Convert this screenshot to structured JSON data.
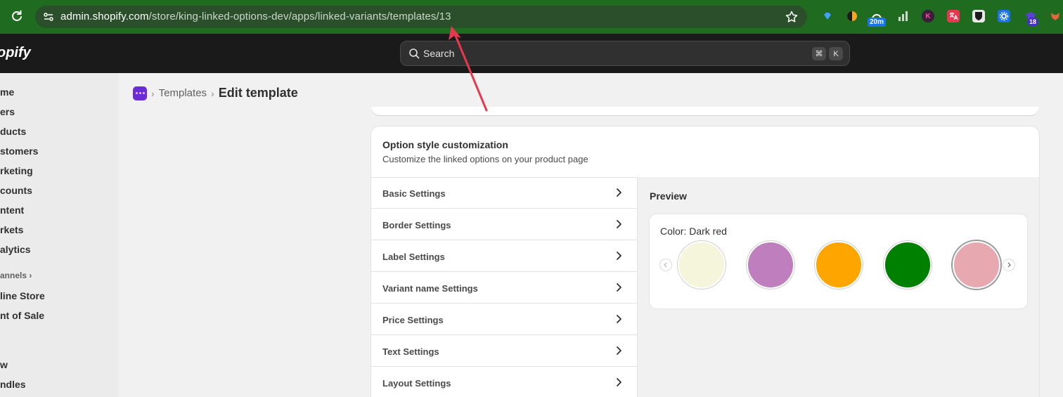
{
  "browser": {
    "url_host": "admin.shopify.com",
    "url_path": "/store/king-linked-options-dev/apps/linked-variants/templates/13",
    "badge_timer": "20m",
    "badge_count": "18",
    "ext_k": "K"
  },
  "topbar": {
    "logo": "opify",
    "search_placeholder": "Search",
    "shortcut_mod": "⌘",
    "shortcut_key": "K"
  },
  "sidebar": {
    "items": [
      "me",
      "ers",
      "ducts",
      "stomers",
      "rketing",
      "counts",
      "ntent",
      "rkets",
      "alytics"
    ],
    "section_label": "annels",
    "channel_items": [
      "line Store",
      "nt of Sale"
    ],
    "app_items": [
      "w",
      "ndles"
    ]
  },
  "breadcrumb": {
    "templates": "Templates",
    "title": "Edit template"
  },
  "card": {
    "title": "Option style customization",
    "subtitle": "Customize the linked options on your product page",
    "settings": [
      "Basic Settings",
      "Border Settings",
      "Label Settings",
      "Variant name Settings",
      "Price Settings",
      "Text Settings",
      "Layout Settings"
    ]
  },
  "preview": {
    "title": "Preview",
    "color_label": "Color: Dark red",
    "swatches": [
      {
        "name": "cream",
        "color": "#f5f5dc"
      },
      {
        "name": "orchid",
        "color": "#bf7fbf"
      },
      {
        "name": "orange",
        "color": "#ffa500"
      },
      {
        "name": "green",
        "color": "#008000"
      },
      {
        "name": "pink",
        "color": "#e8a8b0"
      }
    ]
  },
  "colors": {
    "browser_bar": "#1f6b1f",
    "topbar": "#1a1a1a",
    "annotation_arrow": "#e8384f"
  }
}
